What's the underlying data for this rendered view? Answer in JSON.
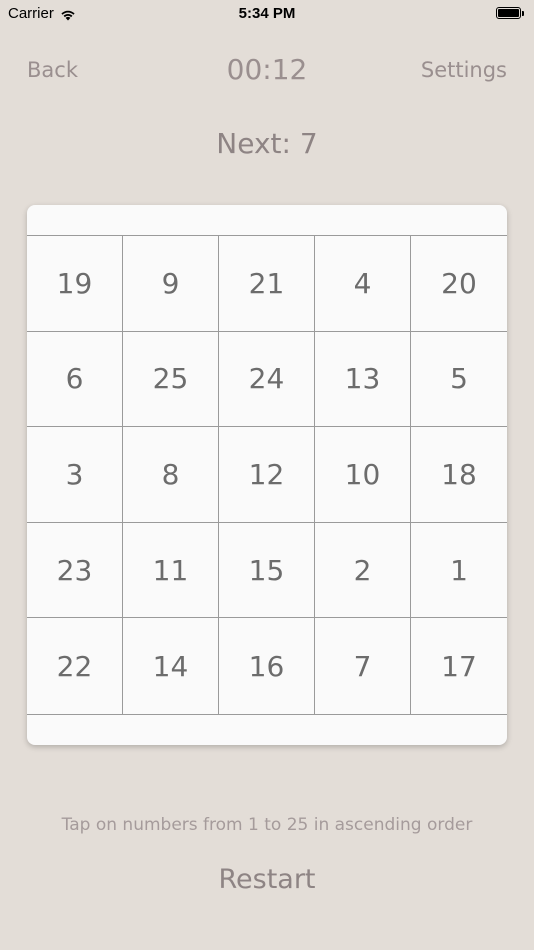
{
  "status_bar": {
    "carrier": "Carrier",
    "time": "5:34 PM",
    "wifi_icon": "wifi-icon",
    "battery_icon": "battery-icon",
    "battery_level": 1.0
  },
  "nav": {
    "back_label": "Back",
    "timer": "00:12",
    "settings_label": "Settings"
  },
  "next": {
    "label": "Next: 7"
  },
  "board": {
    "rows": [
      [
        "19",
        "9",
        "21",
        "4",
        "20"
      ],
      [
        "6",
        "25",
        "24",
        "13",
        "5"
      ],
      [
        "3",
        "8",
        "12",
        "10",
        "18"
      ],
      [
        "23",
        "11",
        "15",
        "2",
        "1"
      ],
      [
        "22",
        "14",
        "16",
        "7",
        "17"
      ]
    ]
  },
  "footer": {
    "instructions": "Tap on numbers from 1 to 25 in ascending order",
    "restart_label": "Restart"
  }
}
